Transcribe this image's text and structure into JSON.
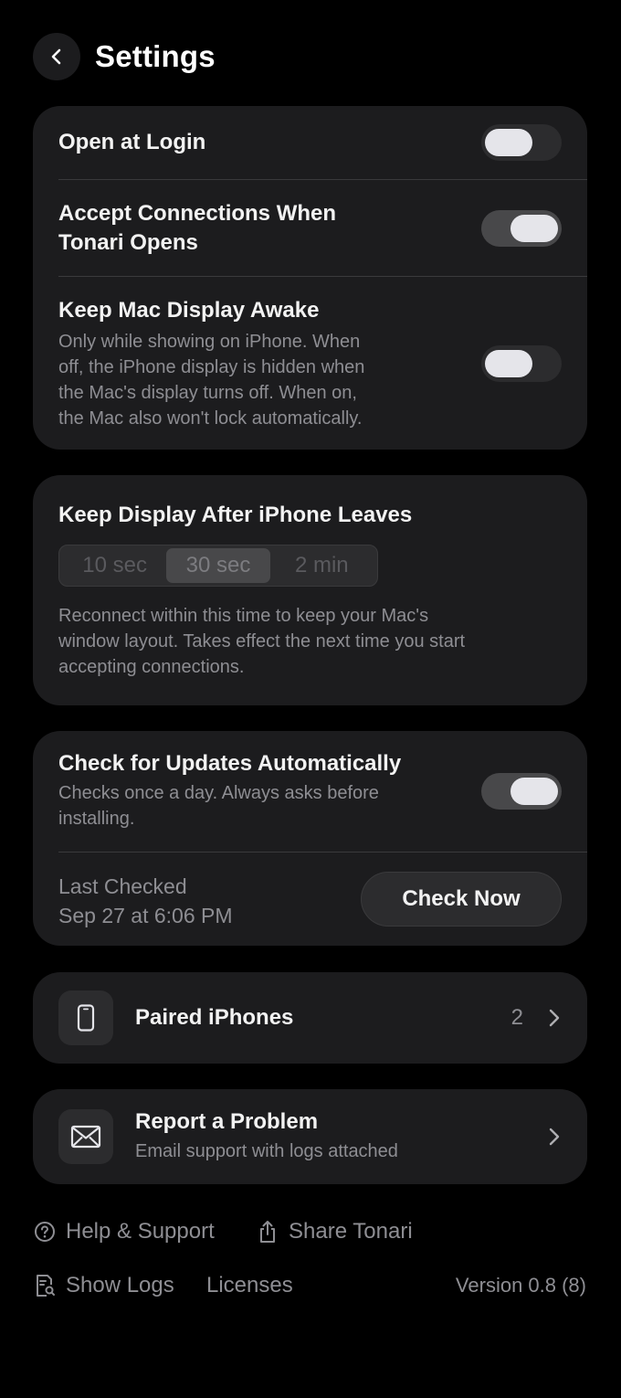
{
  "header": {
    "title": "Settings",
    "back_icon": "chevron-left-icon"
  },
  "general": {
    "open_at_login": {
      "label": "Open at Login",
      "enabled": false
    },
    "accept_connections": {
      "label_line1": "Accept Connections When",
      "label_line2": "Tonari Opens",
      "enabled": true
    },
    "keep_mac_awake": {
      "label": "Keep Mac Display Awake",
      "desc_lines": [
        "Only while showing on iPhone. When",
        "off, the iPhone display is hidden when",
        "the Mac's display turns off. When on,",
        "the Mac also won't lock automatically."
      ],
      "enabled": false
    }
  },
  "keep_display": {
    "label": "Keep Display After iPhone Leaves",
    "options": [
      "10 sec",
      "30 sec",
      "2 min"
    ],
    "selected": "30 sec",
    "desc_lines": [
      "Reconnect within this time to keep your Mac's",
      "window layout. Takes effect the next time you start",
      "accepting connections."
    ]
  },
  "updates": {
    "label": "Check for Updates Automatically",
    "desc_lines": [
      "Checks once a day. Always asks before",
      "installing."
    ],
    "enabled": true,
    "last_checked_label": "Last Checked",
    "last_checked_value": "Sep 27 at 6:06 PM",
    "check_now_label": "Check Now"
  },
  "paired": {
    "label": "Paired iPhones",
    "count": "2",
    "icon": "iphone-icon"
  },
  "report": {
    "label": "Report a Problem",
    "desc": "Email support with logs attached",
    "icon": "envelope-icon"
  },
  "footer": {
    "help_label": "Help & Support",
    "share_label": "Share Tonari",
    "logs_label": "Show Logs",
    "licenses_label": "Licenses",
    "version": "Version 0.8 (8)"
  },
  "colors": {
    "background": "#000000",
    "card": "#1c1c1e",
    "text_primary": "#f2f2f2",
    "text_secondary": "#8e8e93"
  }
}
